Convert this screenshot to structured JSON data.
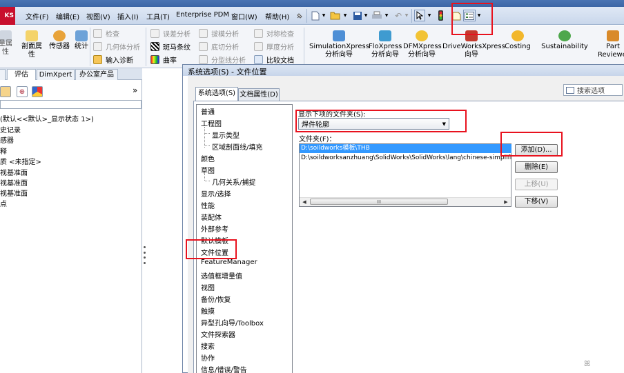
{
  "app": {
    "logo_text": "KS"
  },
  "menubar": {
    "items": [
      "文件(F)",
      "编辑(E)",
      "视图(V)",
      "插入(I)",
      "工具(T)",
      "Enterprise PDM",
      "窗口(W)",
      "帮助(H)"
    ],
    "pin_icon": "pushpin-icon"
  },
  "toolbar_icons": [
    "new-document-icon",
    "open-folder-icon",
    "save-icon",
    "print-icon",
    "undo-icon",
    "select-pointer-icon",
    "traffic-light-icon",
    "file-properties-icon",
    "options-icon"
  ],
  "command_manager": {
    "left_big_buttons": [
      {
        "label_l1": "",
        "label_l2": "剖面属",
        "label_l3": "性"
      },
      {
        "label_l1": "",
        "label_l2": "传感器",
        "label_l3": ""
      },
      {
        "label_l1": "",
        "label_l2": "统计",
        "label_l3": ""
      }
    ],
    "left_cut_l1": "量属",
    "left_cut_l2": "性",
    "small_buttons_1": [
      "检查",
      "几何体分析",
      "输入诊断"
    ],
    "small_buttons_2": [
      "误差分析",
      "斑马条纹",
      "曲率"
    ],
    "small_buttons_3": [
      "拔模分析",
      "底切分析",
      "分型线分析"
    ],
    "small_buttons_4": [
      "对称检查",
      "厚度分析",
      "比较文档"
    ],
    "xpress_buttons": [
      {
        "l1": "SimulationXpress",
        "l2": "分析向导"
      },
      {
        "l1": "FloXpress",
        "l2": "分析向导"
      },
      {
        "l1": "DFMXpress",
        "l2": "分析向导"
      },
      {
        "l1": "DriveWorksXpress",
        "l2": "向导"
      },
      {
        "l1": "Costing",
        "l2": ""
      },
      {
        "l1": "Sustainability",
        "l2": ""
      },
      {
        "l1": "Part",
        "l2": "Reviewer"
      }
    ]
  },
  "feature_manager": {
    "tabs": [
      "评估",
      "DimXpert",
      "办公室产品"
    ],
    "expand_glyph": "»",
    "tree": [
      "(默认<<默认>_显示状态 1>)",
      "史记录",
      "感器",
      "释",
      "质 <未指定>",
      "视基准面",
      "视基准面",
      "视基准面",
      "点"
    ]
  },
  "dialog": {
    "title": "系统选项(S) - 文件位置",
    "tabs": [
      "系统选项(S)",
      "文档属性(D)"
    ],
    "search_label": "搜索选项",
    "categories": [
      "普通",
      "工程图",
      "显示类型",
      "区域剖面线/填充",
      "颜色",
      "草图",
      "几何关系/捕捉",
      "显示/选择",
      "性能",
      "装配体",
      "外部参考",
      "默认模板",
      "文件位置",
      "FeatureManager",
      "选值框增量值",
      "视图",
      "备份/恢复",
      "触摸",
      "异型孔向导/Toolbox",
      "文件探索器",
      "搜索",
      "协作",
      "信息/错误/警告"
    ],
    "selected_category": "文件位置",
    "show_folders_label": "显示下项的文件夹(S):",
    "folder_type_value": "焊件轮廓",
    "folders_label": "文件夹(F)：",
    "folders": [
      "D:\\soildworks模板\\THB",
      "D:\\soildworksanzhuang\\SolidWorks\\SolidWorks\\lang\\chinese-simplified"
    ],
    "buttons": {
      "add": "添加(D)...",
      "delete": "删除(E)",
      "move_up": "上移(U)",
      "move_down": "下移(V)"
    },
    "scroll_grip": "III"
  },
  "colors": {
    "highlight": "#e8121e",
    "selection": "#3399ff"
  }
}
